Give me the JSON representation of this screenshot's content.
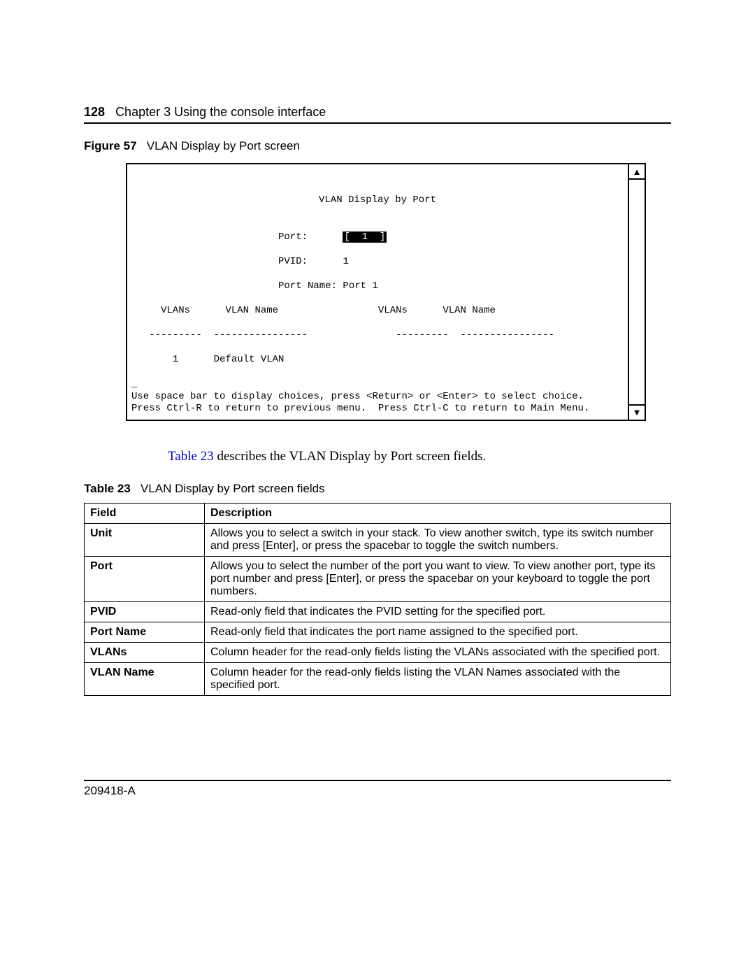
{
  "header": {
    "page_number": "128",
    "chapter_text": "Chapter 3  Using the console interface"
  },
  "figure": {
    "label": "Figure 57",
    "caption": "VLAN Display by Port screen"
  },
  "terminal": {
    "title": "VLAN Display by Port",
    "port_label": "Port:",
    "port_value_raw": "[  1  ]",
    "pvid_label": "PVID:",
    "pvid_value": "1",
    "portname_label": "Port Name:",
    "portname_value": "Port 1",
    "col_vlans": "VLANs",
    "col_vlan_name": "VLAN Name",
    "col_vlans2": "VLANs",
    "col_vlan_name2": "VLAN Name",
    "dash1": "---------",
    "dash2": "----------------",
    "dash3": "---------",
    "dash4": "----------------",
    "row_vlan": "1",
    "row_name": "Default VLAN",
    "footer1": "Use space bar to display choices, press <Return> or <Enter> to select choice.",
    "footer2": "Press Ctrl-R to return to previous menu.  Press Ctrl-C to return to Main Menu."
  },
  "body_para": {
    "link_text": "Table 23",
    "rest": " describes the VLAN Display by Port screen fields."
  },
  "table": {
    "label": "Table 23",
    "caption": "VLAN Display by Port screen fields",
    "head_field": "Field",
    "head_desc": "Description",
    "rows": [
      {
        "field": "Unit",
        "desc": "Allows you to select a switch in your stack. To view another switch, type its switch number and press [Enter], or press the spacebar to toggle the switch numbers."
      },
      {
        "field": "Port",
        "desc": "Allows you to select the number of the port you want to view. To view another port, type its port number and press [Enter], or press the spacebar on your keyboard to toggle the port numbers."
      },
      {
        "field": "PVID",
        "desc": "Read-only field that indicates the PVID setting for the specified port."
      },
      {
        "field": "Port Name",
        "desc": "Read-only field that indicates the port name assigned to the specified port."
      },
      {
        "field": "VLANs",
        "desc": "Column header for the read-only fields listing the VLANs associated with the specified port."
      },
      {
        "field": "VLAN Name",
        "desc": "Column header for the read-only fields listing the VLAN Names associated with the specified port."
      }
    ]
  },
  "footer": {
    "doc_id": "209418-A"
  }
}
